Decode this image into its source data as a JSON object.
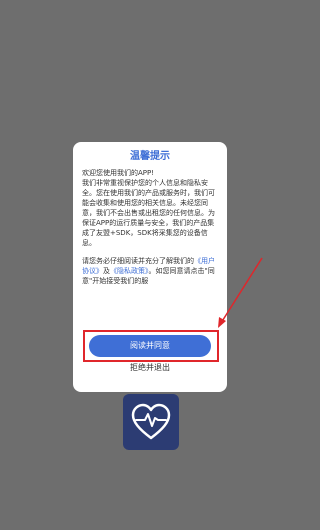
{
  "app_icon": {
    "icon": "heartbeat-icon",
    "color": "#2c3c73"
  },
  "dialog": {
    "title": "温馨提示",
    "body_intro": "欢迎您使用我们的APP!\n我们非常重视保护您的个人信息和隐私安全。您在使用我们的产品或服务时，我们可能会收集和使用您的相关信息。未经您同意，我们不会出售或出租您的任何信息。为保证APP的运行质量与安全，我们的产品集成了友盟+SDK，SDK将采集您的设备信息。",
    "body_notice_prefix": "请您务必仔细阅读并充分了解我们的",
    "user_agreement_link": "《用户协议》",
    "conjunction": "及",
    "privacy_policy_link": "《隐私政策》",
    "body_notice_suffix": "。如您同意请点击\"同意\"开始接受我们的服",
    "agree_button": "阅读并同意",
    "decline_link": "拒绝并退出"
  },
  "colors": {
    "accent": "#3f6fd6",
    "annotation": "#e0262b",
    "overlay": "#6e6e6e"
  }
}
